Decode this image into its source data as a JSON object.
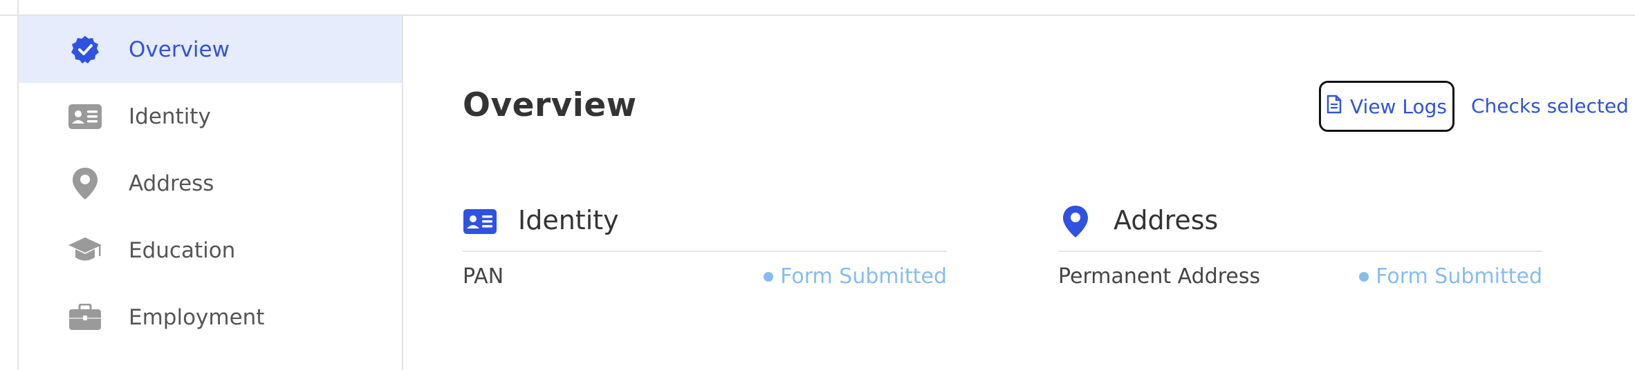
{
  "colors": {
    "accent": "#2f52e0",
    "active_bg": "#e6ecfc",
    "status": "#85bcf0",
    "icon_gray": "#9a9a9a"
  },
  "sidebar": {
    "items": [
      {
        "label": "Overview",
        "icon": "verified-badge-icon",
        "active": true
      },
      {
        "label": "Identity",
        "icon": "id-card-icon",
        "active": false
      },
      {
        "label": "Address",
        "icon": "map-pin-icon",
        "active": false
      },
      {
        "label": "Education",
        "icon": "graduation-cap-icon",
        "active": false
      },
      {
        "label": "Employment",
        "icon": "briefcase-icon",
        "active": false
      }
    ]
  },
  "main": {
    "title": "Overview",
    "view_logs_label": "View Logs",
    "view_logs_icon": "document-icon",
    "checks_link": "Checks selected"
  },
  "sections": [
    {
      "title": "Identity",
      "icon": "id-card-icon",
      "rows": [
        {
          "label": "PAN",
          "status": "Form Submitted"
        }
      ]
    },
    {
      "title": "Address",
      "icon": "map-pin-icon",
      "rows": [
        {
          "label": "Permanent Address",
          "status": "Form Submitted"
        }
      ]
    }
  ]
}
